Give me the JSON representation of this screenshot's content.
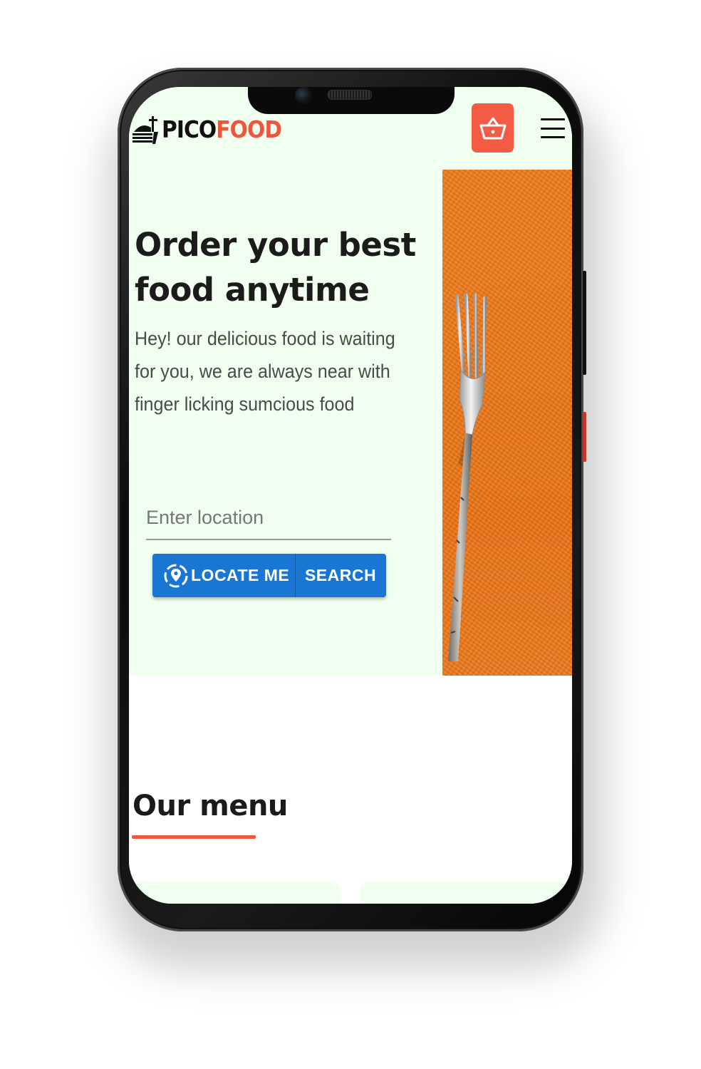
{
  "brand": {
    "logo_part1": "PICO",
    "logo_part2": "FOOD",
    "accent_color": "#f0563c",
    "hero_bg": "#f0fff0"
  },
  "header": {
    "cart_icon": "shopping-basket-icon",
    "menu_icon": "hamburger-menu-icon"
  },
  "hero": {
    "title": "Order your best food anytime",
    "description": "Hey! our delicious food is waiting for you, we are always near with finger licking sumcious food"
  },
  "location": {
    "placeholder": "Enter location",
    "value": ""
  },
  "actions": {
    "locate_label": "LOCATE ME",
    "locate_icon": "location-target-icon",
    "search_label": "SEARCH",
    "button_color": "#1976d2"
  },
  "menu": {
    "title": "Our menu"
  }
}
